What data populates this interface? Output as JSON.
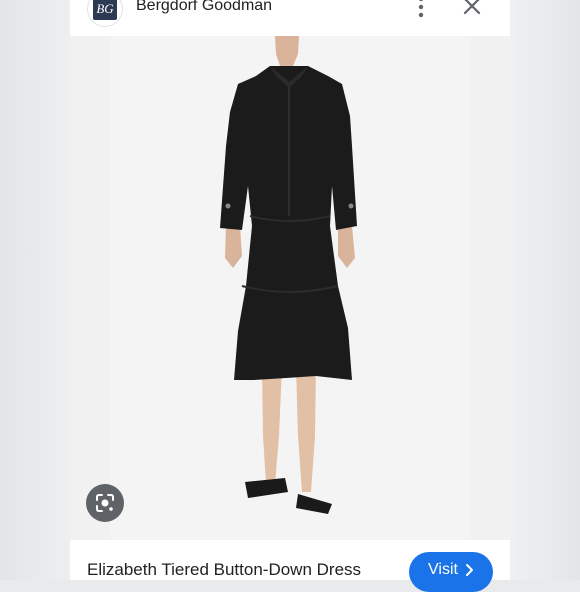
{
  "header": {
    "logo_text": "BG",
    "site_name": "Bergdorf Goodman",
    "more_icon": "more-vert-icon",
    "close_icon": "close-icon"
  },
  "image": {
    "lens_icon": "lens-icon"
  },
  "footer": {
    "title": "Elizabeth Tiered Button-Down Dress",
    "visit_label": "Visit",
    "visit_icon": "chevron-right-icon"
  },
  "colors": {
    "visit_button": "#1a73e8",
    "lens_button": "#5f6368",
    "dress": "#1b1b1b"
  }
}
